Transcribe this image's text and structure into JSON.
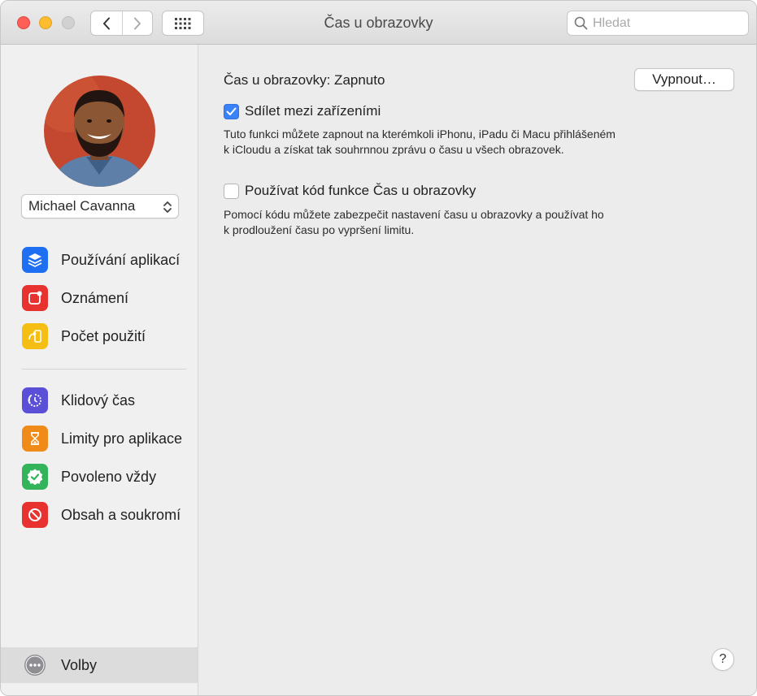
{
  "window": {
    "title": "Čas u obrazovky",
    "search_placeholder": "Hledat"
  },
  "sidebar": {
    "user": "Michael Cavanna",
    "items": [
      {
        "label": "Používání aplikací",
        "icon": "stack-icon",
        "color": "#1f6ff2"
      },
      {
        "label": "Oznámení",
        "icon": "notification-icon",
        "color": "#e8322f"
      },
      {
        "label": "Počet použití",
        "icon": "pickup-icon",
        "color": "#f4be12"
      },
      {
        "label": "Klidový čas",
        "icon": "downtime-icon",
        "color": "#5b4fd8"
      },
      {
        "label": "Limity pro aplikace",
        "icon": "hourglass-icon",
        "color": "#f08b1a"
      },
      {
        "label": "Povoleno vždy",
        "icon": "checkmark-seal-icon",
        "color": "#33b35a"
      },
      {
        "label": "Obsah a soukromí",
        "icon": "restriction-icon",
        "color": "#e8322f"
      }
    ],
    "options_label": "Volby"
  },
  "main": {
    "status": "Čas u obrazovky: Zapnuto",
    "turn_off_label": "Vypnout…",
    "share": {
      "label": "Sdílet mezi zařízeními",
      "checked": true,
      "description_line1": "Tuto funkci můžete zapnout na kterémkoli iPhonu, iPadu či Macu přihlášeném",
      "description_line2": "k iCloudu a získat tak souhrnnou zprávu o času u všech obrazovek."
    },
    "passcode": {
      "label": "Používat kód funkce Čas u obrazovky",
      "checked": false,
      "description_line1": "Pomocí kódu můžete zabezpečit nastavení času u obrazovky a používat ho",
      "description_line2": "k prodloužení času po vypršení limitu."
    },
    "help_label": "?"
  }
}
